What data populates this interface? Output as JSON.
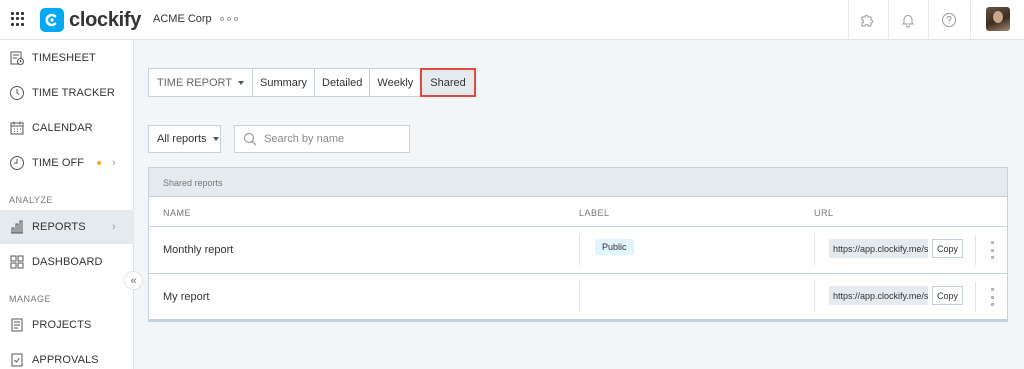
{
  "app": {
    "name": "clockify",
    "workspace": "ACME Corp"
  },
  "sidebar": {
    "items": [
      {
        "label": "TIMESHEET",
        "icon": "timesheet-icon"
      },
      {
        "label": "TIME TRACKER",
        "icon": "clock-icon"
      },
      {
        "label": "CALENDAR",
        "icon": "calendar-icon"
      },
      {
        "label": "TIME OFF",
        "icon": "time-off-icon"
      },
      {
        "label": "REPORTS",
        "icon": "reports-icon"
      },
      {
        "label": "DASHBOARD",
        "icon": "dashboard-icon"
      },
      {
        "label": "PROJECTS",
        "icon": "projects-icon"
      },
      {
        "label": "APPROVALS",
        "icon": "approvals-icon"
      }
    ],
    "sections": {
      "analyze": "ANALYZE",
      "manage": "MANAGE"
    },
    "collapse_glyph": "«"
  },
  "tabs": {
    "time_report": "TIME REPORT",
    "summary": "Summary",
    "detailed": "Detailed",
    "weekly": "Weekly",
    "shared": "Shared"
  },
  "filters": {
    "report_type": "All reports",
    "search_placeholder": "Search by name"
  },
  "table": {
    "title": "Shared reports",
    "columns": {
      "name": "NAME",
      "label": "LABEL",
      "url": "URL"
    },
    "rows": [
      {
        "name": "Monthly report",
        "label": "Public",
        "url": "https://app.clockify.me/shared/",
        "copy": "Copy"
      },
      {
        "name": "My report",
        "label": "",
        "url": "https://app.clockify.me/shared/",
        "copy": "Copy"
      }
    ]
  },
  "colors": {
    "accent": "#03a9f4",
    "highlight": "#e04b3b",
    "active_bg": "#e4eaee",
    "badge_bg": "#e1f5fe"
  }
}
